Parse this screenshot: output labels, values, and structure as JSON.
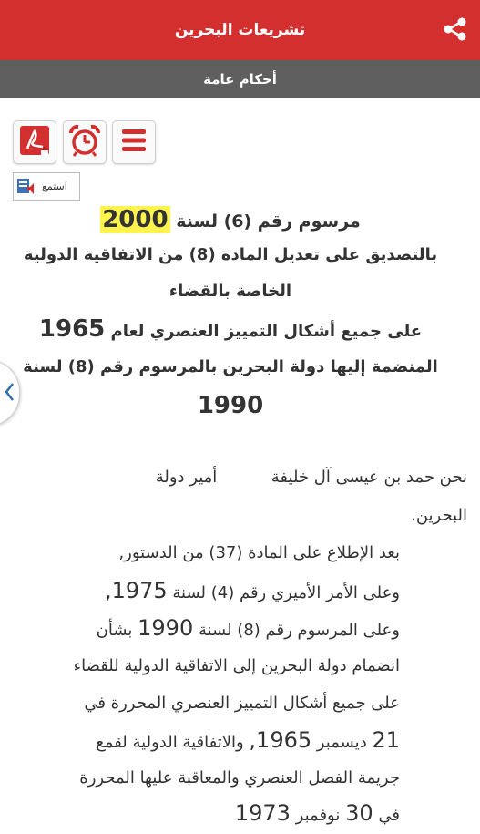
{
  "header": {
    "title": "تشريعات البحرين"
  },
  "subheader": {
    "title": "أحكام عامة"
  },
  "toolbar": {
    "listen_label": "استمع"
  },
  "heading": {
    "line1_prefix": "مرسوم رقم (6) لسنة",
    "line1_year": "2000",
    "line2": "بالتصديق على تعديل المادة (8) من الاتفاقية الدولية",
    "line3": "الخاصة بالقضاء",
    "line4_prefix": "على جميع أشكال التمييز العنصري لعام",
    "line4_year": "1965",
    "line5": "المنضمة إليها دولة البحرين بالمرسوم رقم (8) لسنة",
    "line6": "1990"
  },
  "body": {
    "intro_name": "نحن حمد بن عيسى آل خليفة",
    "intro_title": "أمير دولة",
    "intro_cont": "البحرين.",
    "p1": "بعد الإطلاع على المادة (37) من الدستور,",
    "p2_prefix": "وعلى الأمر الأميري رقم (4) لسنة",
    "p2_year": "1975,",
    "p3_prefix": "وعلى المرسوم رقم (8) لسنة",
    "p3_year": "1990",
    "p3_suffix": "بشأن",
    "p4": "انضمام دولة البحرين إلى الاتفاقية الدولية للقضاء",
    "p5": "على جميع أشكال التمييز العنصري المحررة في",
    "p6_day": "21",
    "p6_month": "ديسمبر",
    "p6_year": "1965,",
    "p6_rest": "والاتفاقية الدولية لقمع",
    "p7": "جريمة الفصل العنصري والمعاقبة عليها المحررة",
    "p8_prefix": "في",
    "p8_day": "30",
    "p8_month": "نوفمبر",
    "p8_year": "1973"
  },
  "colors": {
    "topbar": "#d32f2f",
    "subbar": "#5f5f5f",
    "highlight": "#fff34d",
    "icon_red": "#d32f2f"
  },
  "icons": [
    "share-icon",
    "pdf-icon",
    "alarm-clock-icon",
    "menu-icon",
    "speaker-icon",
    "chevron-left-icon"
  ]
}
